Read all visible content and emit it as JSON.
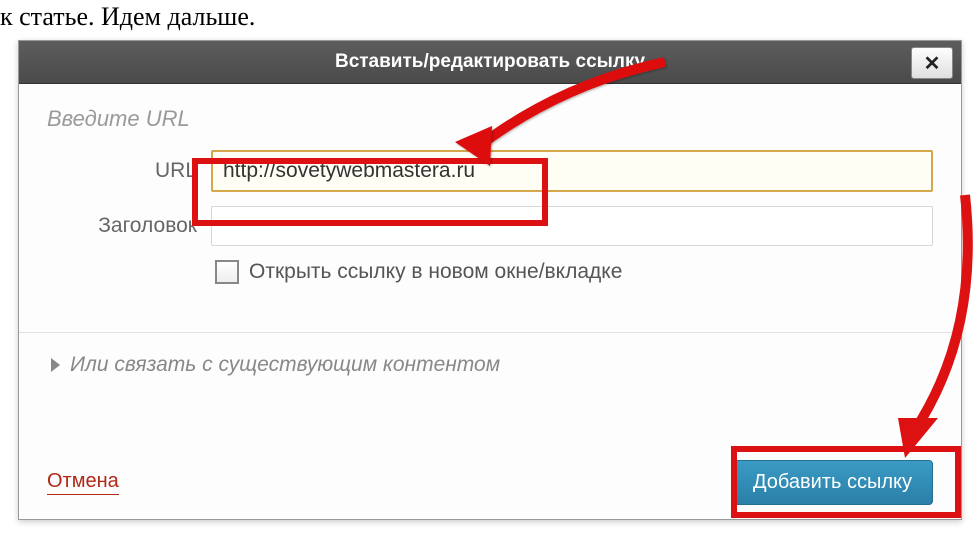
{
  "background": {
    "line1": "к статье. Идем дальше."
  },
  "dialog": {
    "title": "Вставить/редактировать ссылку",
    "section_label": "Введите URL",
    "url_label": "URL",
    "url_value": "http://sovetywebmastera.ru",
    "title_label": "Заголовок",
    "title_value": "",
    "checkbox_label": "Открыть ссылку в новом окне/вкладке",
    "expand_label": "Или связать с существующим контентом",
    "cancel_label": "Отмена",
    "add_label": "Добавить ссылку"
  }
}
